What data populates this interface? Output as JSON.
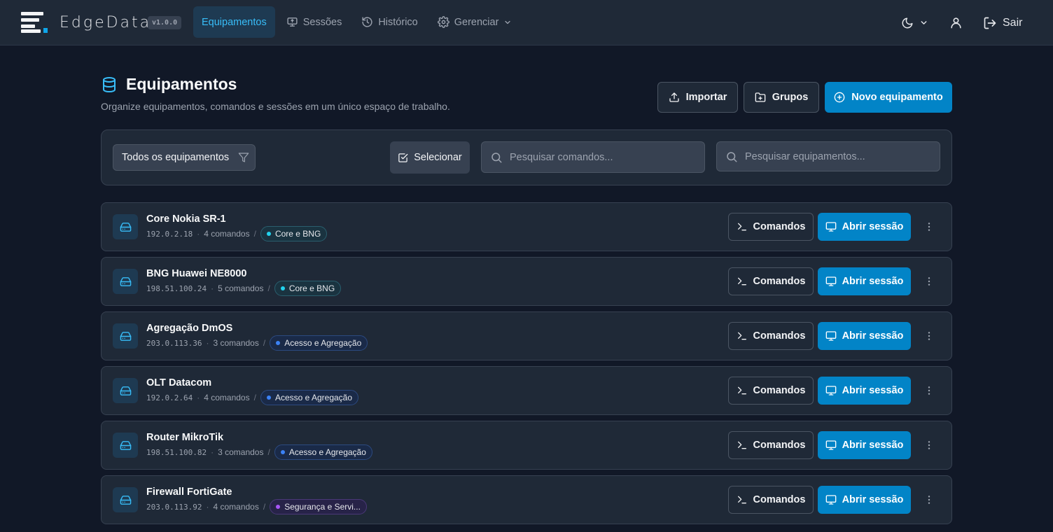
{
  "app": {
    "brand": "EdgeData",
    "version": "v1.0.0"
  },
  "nav": {
    "items": [
      {
        "label": "Equipamentos",
        "icon": "none",
        "active": true
      },
      {
        "label": "Sessões",
        "icon": "monitor-icon",
        "active": false
      },
      {
        "label": "Histórico",
        "icon": "history-icon",
        "active": false
      },
      {
        "label": "Gerenciar",
        "icon": "gear-icon",
        "active": false
      }
    ],
    "logout_label": "Sair"
  },
  "header": {
    "title": "Equipamentos",
    "subtitle": "Organize equipamentos, comandos e sessões em um único espaço de trabalho.",
    "import_label": "Importar",
    "groups_label": "Grupos",
    "new_label": "Novo equipamento"
  },
  "filters": {
    "select_value": "Todos os equipamentos",
    "select_button_label": "Selecionar",
    "search_commands_placeholder": "Pesquisar comandos...",
    "search_devices_placeholder": "Pesquisar equipamentos..."
  },
  "colors": {
    "accent": "#0284c7",
    "tag_core": "#22d3ee",
    "tag_access": "#3b82f6",
    "tag_security": "#a855f7"
  },
  "devices": [
    {
      "name": "Core Nokia SR-1",
      "ip": "192.0.2.18",
      "commands": "4 comandos",
      "group": "Core e BNG",
      "group_color": "#22d3ee",
      "group_border": "#2a5f6e",
      "group_bg": "#1a3340"
    },
    {
      "name": "BNG Huawei NE8000",
      "ip": "198.51.100.24",
      "commands": "5 comandos",
      "group": "Core e BNG",
      "group_color": "#22d3ee",
      "group_border": "#2a5f6e",
      "group_bg": "#1a3340"
    },
    {
      "name": "Agregação DmOS",
      "ip": "203.0.113.36",
      "commands": "3 comandos",
      "group": "Acesso e Agregação",
      "group_color": "#3b82f6",
      "group_border": "#2c4a80",
      "group_bg": "#1a2a48"
    },
    {
      "name": "OLT Datacom",
      "ip": "192.0.2.64",
      "commands": "4 comandos",
      "group": "Acesso e Agregação",
      "group_color": "#3b82f6",
      "group_border": "#2c4a80",
      "group_bg": "#1a2a48"
    },
    {
      "name": "Router MikroTik",
      "ip": "198.51.100.82",
      "commands": "3 comandos",
      "group": "Acesso e Agregação",
      "group_color": "#3b82f6",
      "group_border": "#2c4a80",
      "group_bg": "#1a2a48"
    },
    {
      "name": "Firewall FortiGate",
      "ip": "203.0.113.92",
      "commands": "4 comandos",
      "group": "Segurança e Servi...",
      "group_color": "#a855f7",
      "group_border": "#4a3878",
      "group_bg": "#272348"
    }
  ],
  "device_actions": {
    "commands_label": "Comandos",
    "open_session_label": "Abrir sessão"
  }
}
